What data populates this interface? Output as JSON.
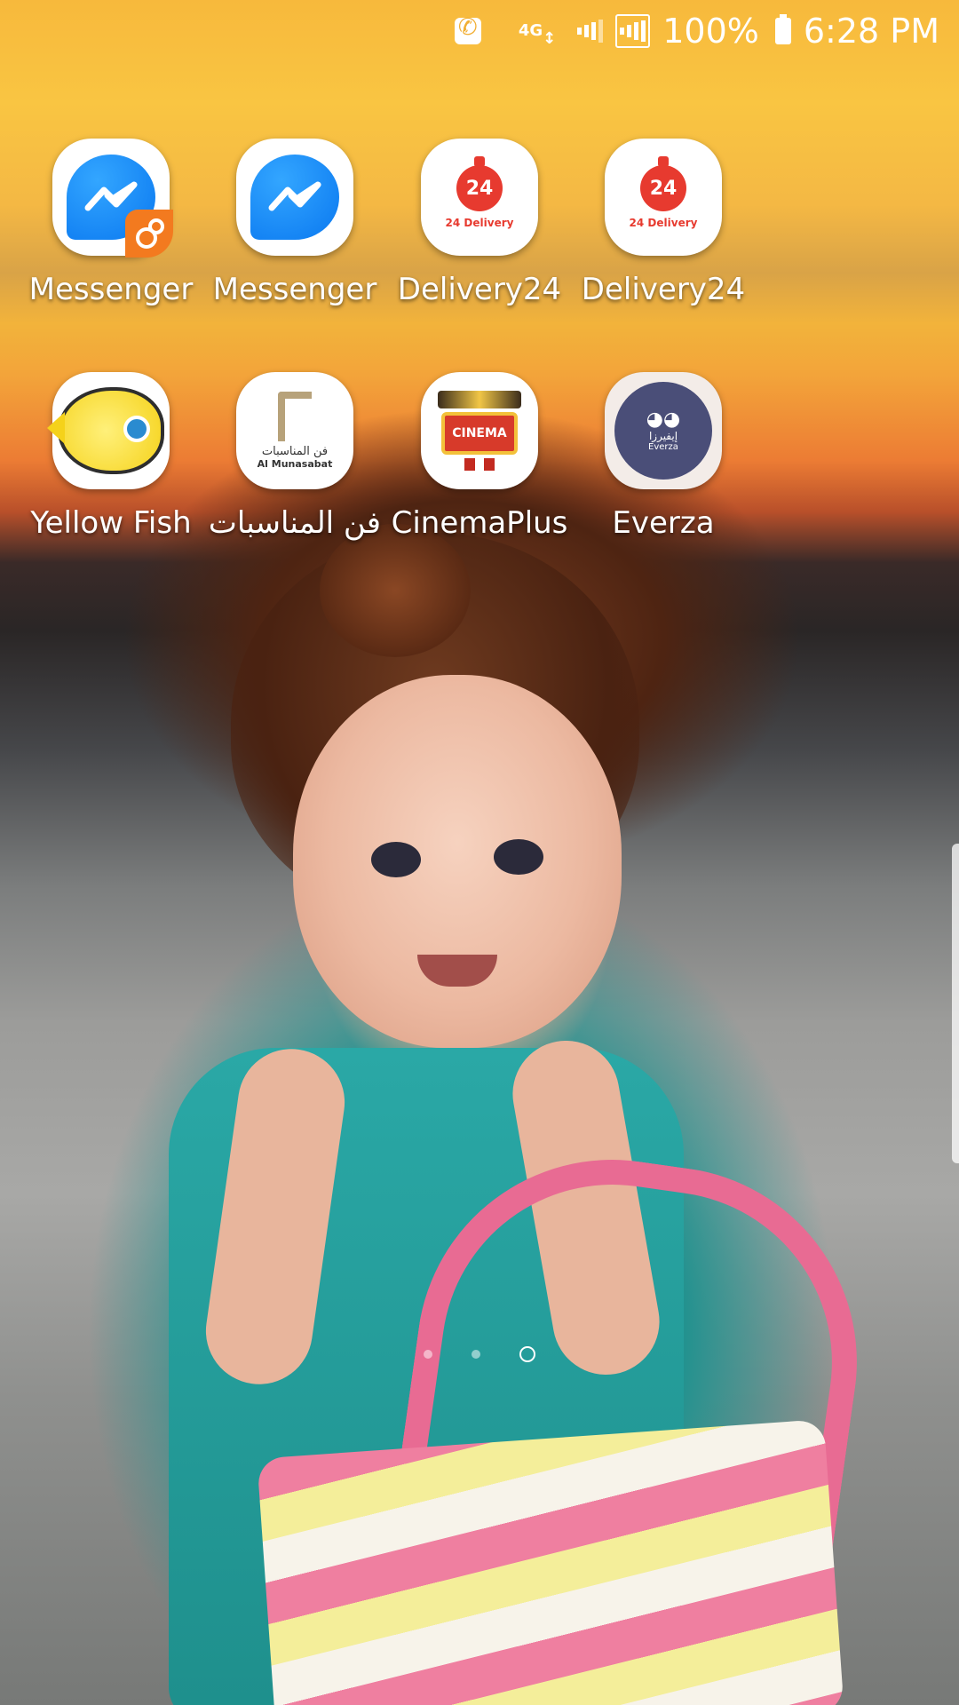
{
  "status_bar": {
    "network_type": "4G",
    "battery_percent": "100%",
    "time": "6:28 PM",
    "icons": [
      "call-icon",
      "network-type-icon",
      "signal-icon",
      "signal-icon",
      "battery-icon"
    ]
  },
  "apps": [
    {
      "label": "Messenger",
      "icon": "messenger-icon",
      "dual": true
    },
    {
      "label": "Messenger",
      "icon": "messenger-icon",
      "dual": false
    },
    {
      "label": "Delivery24",
      "icon": "delivery24-icon",
      "icon_text": "24 Delivery",
      "pin_text": "24"
    },
    {
      "label": "Delivery24",
      "icon": "delivery24-icon",
      "icon_text": "24 Delivery",
      "pin_text": "24"
    },
    {
      "label": "Yellow Fish",
      "icon": "yellow-fish-icon"
    },
    {
      "label": "فن المناسبات",
      "icon": "al-munasabat-icon",
      "icon_text_ar": "فن المناسبات",
      "icon_text_en": "Al Munasabat"
    },
    {
      "label": "CinemaPlus",
      "icon": "cinema-icon",
      "icon_text": "CINEMA"
    },
    {
      "label": "Everza",
      "icon": "everza-icon",
      "icon_text_ar": "إيفيرزا",
      "icon_text_en": "Everza"
    }
  ],
  "page_indicator": {
    "pages": 3,
    "current": 3
  },
  "colors": {
    "messenger_blue": "#0a78f0",
    "delivery_red": "#e73a2f",
    "dual_badge_orange": "#f37a1f",
    "everza_purple": "#4a4e78"
  }
}
